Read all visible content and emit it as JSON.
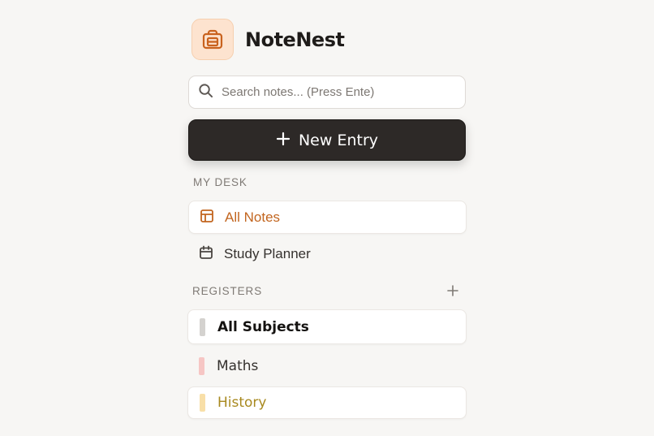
{
  "app": {
    "name": "NoteNest",
    "logo_icon": "briefcase-icon"
  },
  "search": {
    "placeholder": "Search notes... (Press Ente)",
    "value": ""
  },
  "new_entry": {
    "label": "New Entry"
  },
  "my_desk": {
    "title": "MY DESK",
    "items": [
      {
        "label": "All Notes",
        "icon": "layout-icon",
        "active": true
      },
      {
        "label": "Study Planner",
        "icon": "calendar-icon",
        "active": false
      }
    ]
  },
  "registers": {
    "title": "REGISTERS",
    "items": [
      {
        "label": "All Subjects",
        "color": "#d4d2cf"
      },
      {
        "label": "Maths",
        "color": "#f6c6c4"
      },
      {
        "label": "History",
        "color": "#f8dfa8",
        "text_color": "#a8891f"
      }
    ]
  },
  "colors": {
    "accent": "#c2651f",
    "button_dark": "#2d2927"
  }
}
